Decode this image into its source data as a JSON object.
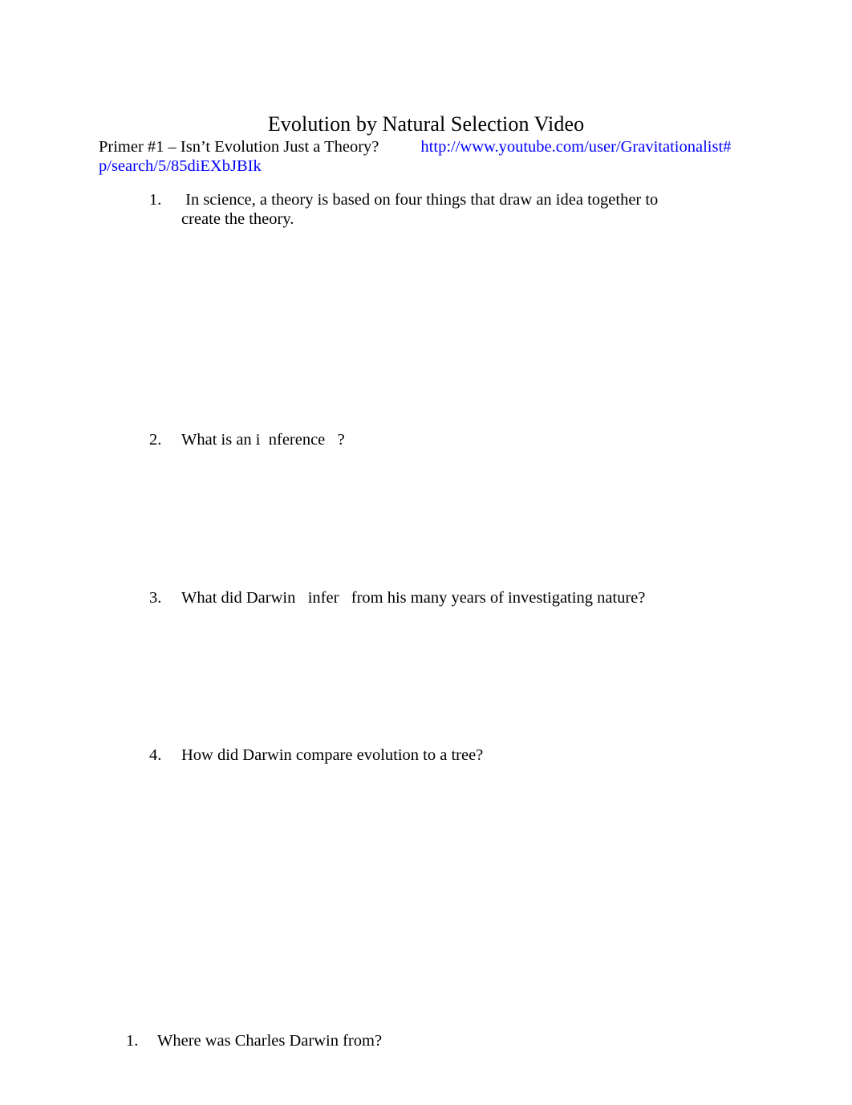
{
  "document": {
    "title": "Evolution by Natural Selection Video",
    "primer": {
      "label": "Primer #1 – Isn’t Evolution Just a Theory?",
      "url_line1": "http://www.youtube.com/user/",
      "url_line2": "Gravitationalist#p/search/5/85diEXbJBIk",
      "url_full": "http://www.youtube.com/user/Gravitationalist#p/search/5/85diEXbJBIk",
      "link_color": "#0000ff"
    },
    "questions_group_1": [
      {
        "marker": "1.",
        "text": " In science, a theory is based on four things that draw an idea together to create the theory."
      },
      {
        "marker": "2.",
        "text": "What is an i  nference   ?"
      },
      {
        "marker": "3.",
        "text": "What did Darwin   infer   from his many years of investigating nature?"
      },
      {
        "marker": "4.",
        "text": "How did Darwin compare evolution to a tree?"
      }
    ],
    "questions_group_2": [
      {
        "marker": "1.",
        "text": "Where was Charles Darwin from?"
      }
    ]
  }
}
